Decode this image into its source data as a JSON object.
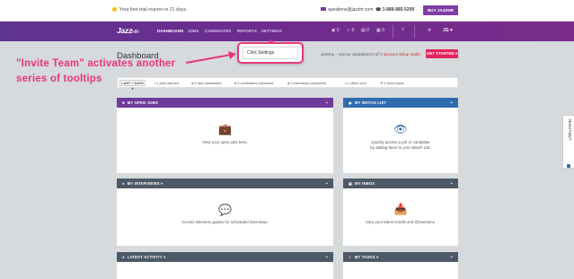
{
  "notice": {
    "trial_prefix": "Your free trial ",
    "trial_highlight": "expires in 21 days.",
    "email": "questions@jazzhr.com",
    "phone": "1-888-885-5299",
    "buy_label": "BUY JAZZHR"
  },
  "nav": {
    "logo_main": "Jazz",
    "logo_sub": "HR",
    "items": [
      "DASHBOARD",
      "JOBS",
      "CANDIDATES",
      "REPORTS",
      "SETTINGS"
    ],
    "counts": [
      "0",
      "0",
      "0",
      "0"
    ],
    "user_initials": "JG"
  },
  "page": {
    "title": "Dashboard",
    "progress_prefix": "Jeremy – you've completed 0 of ",
    "progress_link": "3 account setup tasks.",
    "get_started": "GET STARTED"
  },
  "popover": {
    "text": "Click Settings"
  },
  "annotation": {
    "line1": "\"Invite Team\" activates another",
    "line2": "series of tooltips"
  },
  "stats": {
    "range": "LAST 7 DAYS",
    "items": [
      "1 jobs opened",
      "0 new candidates",
      "0 candidates advanced",
      "0 interviews completed",
      "0 offers sent",
      "0 hires made"
    ]
  },
  "panels": {
    "open_jobs": {
      "title": "MY OPEN JOBS",
      "message": "View your open jobs here."
    },
    "watch_list": {
      "title": "MY WATCH LIST",
      "message_1": "Quickly access a job or candidate",
      "message_2": "by adding them to your Watch List."
    },
    "interviews": {
      "title": "MY INTERVIEWS",
      "message": "Access interview guides for scheduled interviews."
    },
    "inbox": {
      "title": "MY INBOX",
      "message": "View your latest emails and @mentions."
    },
    "activity": {
      "title": "LATEST ACTIVITY"
    },
    "tasks": {
      "title": "MY TASKS"
    }
  },
  "help": {
    "label": "Need help?"
  },
  "colors": {
    "brand_purple": "#6f3a9a",
    "accent_pink": "#e33a7d",
    "blue": "#2f6cae",
    "slate": "#4d5966"
  }
}
